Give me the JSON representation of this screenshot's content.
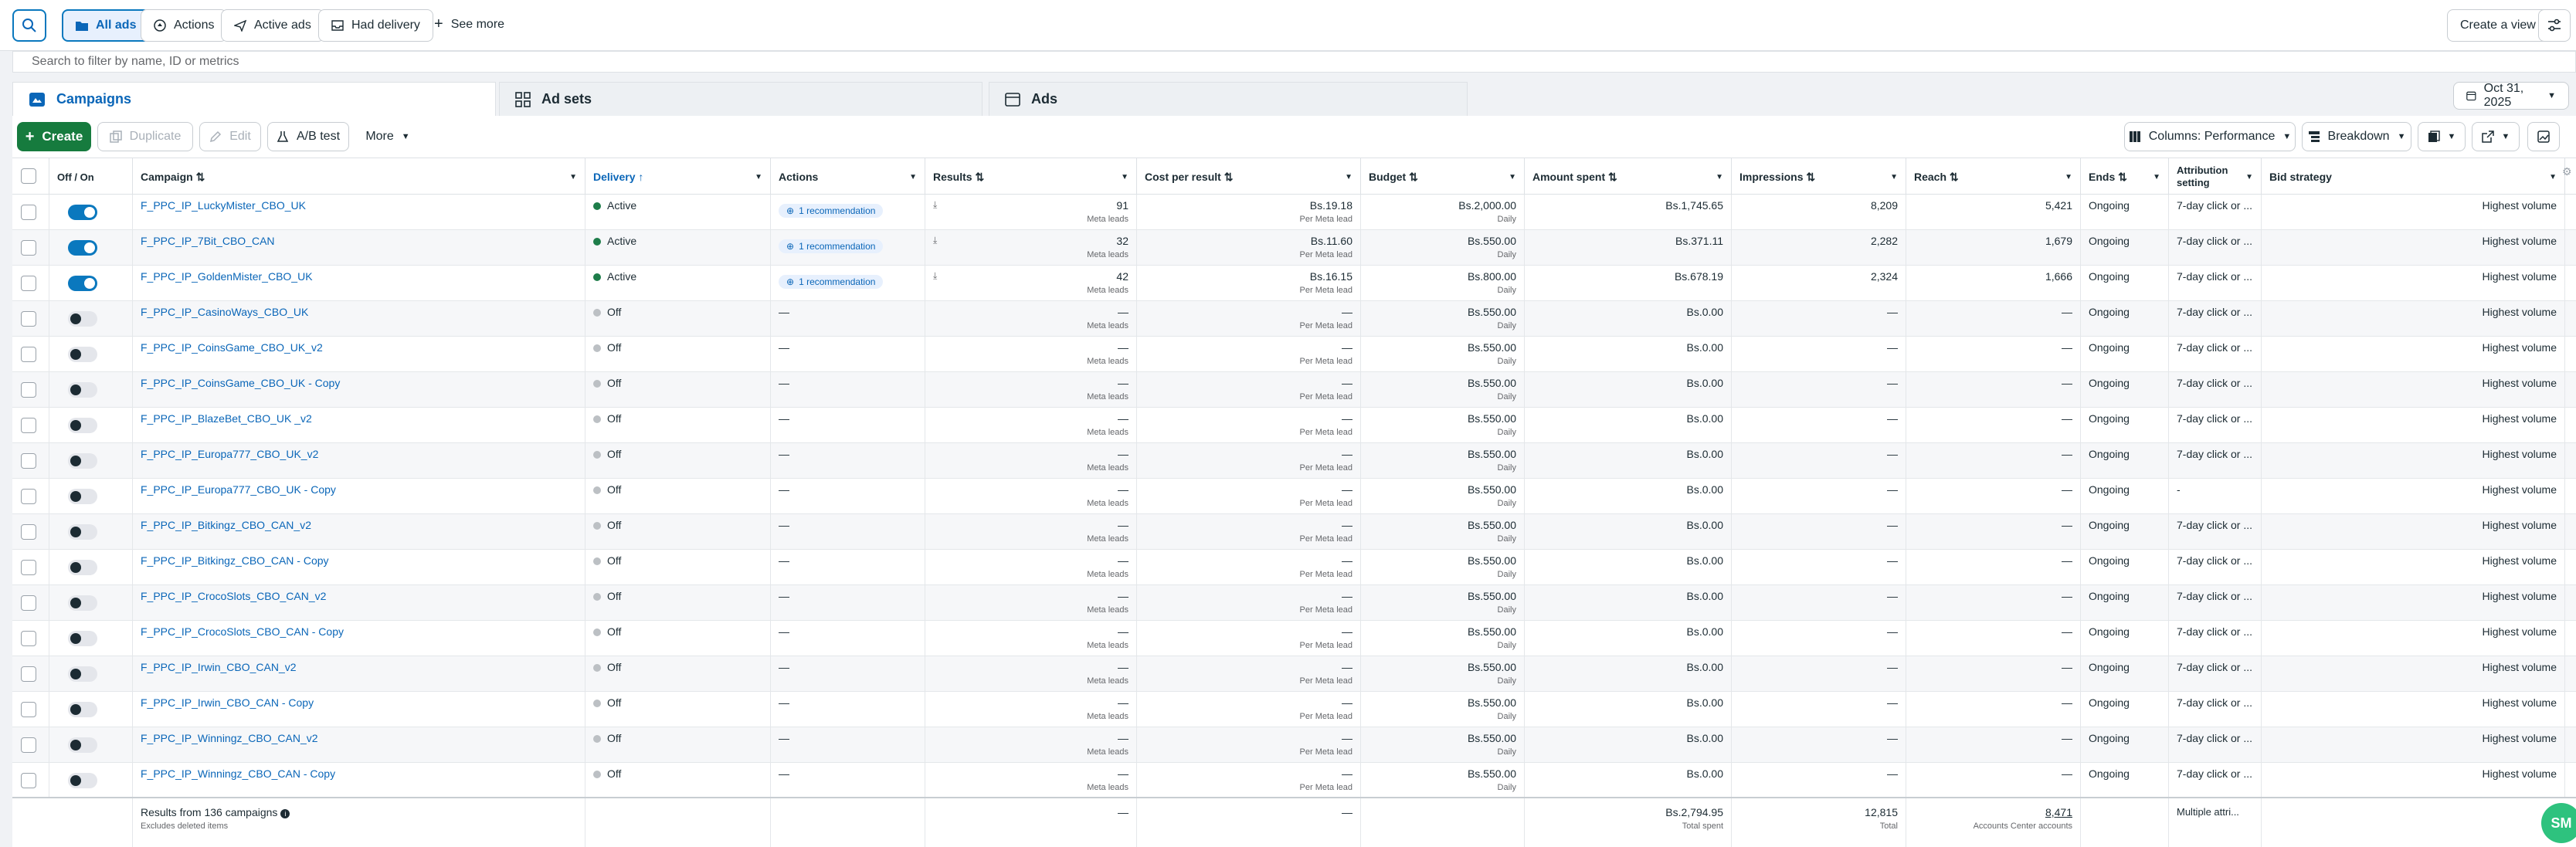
{
  "filters": {
    "all_ads": "All ads",
    "actions": "Actions",
    "active_ads": "Active ads",
    "had_delivery": "Had delivery",
    "see_more": "See more",
    "create_view": "Create a view"
  },
  "search": {
    "placeholder": "Search to filter by name, ID or metrics"
  },
  "tabs": {
    "campaigns": "Campaigns",
    "ad_sets": "Ad sets",
    "ads": "Ads"
  },
  "date": "Oct 31, 2025",
  "toolbar": {
    "create": "Create",
    "duplicate": "Duplicate",
    "edit": "Edit",
    "ab_test": "A/B test",
    "more": "More",
    "columns": "Columns: Performance",
    "breakdown": "Breakdown"
  },
  "headers": {
    "off_on": "Off / On",
    "campaign": "Campaign",
    "delivery": "Delivery",
    "actions": "Actions",
    "results": "Results",
    "cost_per_result": "Cost per result",
    "budget": "Budget",
    "amount_spent": "Amount spent",
    "impressions": "Impressions",
    "reach": "Reach",
    "ends": "Ends",
    "attribution": "Attribution setting",
    "bid_strategy": "Bid strategy"
  },
  "rows": [
    {
      "on": true,
      "name": "F_PPC_IP_LuckyMister_CBO_UK",
      "delivery": "Active",
      "action": "1 recommendation",
      "results": "91",
      "results_sub": "Meta leads",
      "cost": "Bs.19.18",
      "cost_sub": "Per Meta lead",
      "budget": "Bs.2,000.00",
      "budget_sub": "Daily",
      "spent": "Bs.1,745.65",
      "impressions": "8,209",
      "reach": "5,421",
      "ends": "Ongoing",
      "attribution": "7-day click or ...",
      "bid": "Highest volume"
    },
    {
      "on": true,
      "name": "F_PPC_IP_7Bit_CBO_CAN",
      "delivery": "Active",
      "action": "1 recommendation",
      "results": "32",
      "results_sub": "Meta leads",
      "cost": "Bs.11.60",
      "cost_sub": "Per Meta lead",
      "budget": "Bs.550.00",
      "budget_sub": "Daily",
      "spent": "Bs.371.11",
      "impressions": "2,282",
      "reach": "1,679",
      "ends": "Ongoing",
      "attribution": "7-day click or ...",
      "bid": "Highest volume"
    },
    {
      "on": true,
      "name": "F_PPC_IP_GoldenMister_CBO_UK",
      "delivery": "Active",
      "action": "1 recommendation",
      "results": "42",
      "results_sub": "Meta leads",
      "cost": "Bs.16.15",
      "cost_sub": "Per Meta lead",
      "budget": "Bs.800.00",
      "budget_sub": "Daily",
      "spent": "Bs.678.19",
      "impressions": "2,324",
      "reach": "1,666",
      "ends": "Ongoing",
      "attribution": "7-day click or ...",
      "bid": "Highest volume"
    },
    {
      "on": false,
      "name": "F_PPC_IP_CasinoWays_CBO_UK",
      "delivery": "Off",
      "action": "—",
      "results": "—",
      "results_sub": "Meta leads",
      "cost": "—",
      "cost_sub": "Per Meta lead",
      "budget": "Bs.550.00",
      "budget_sub": "Daily",
      "spent": "Bs.0.00",
      "impressions": "—",
      "reach": "—",
      "ends": "Ongoing",
      "attribution": "7-day click or ...",
      "bid": "Highest volume"
    },
    {
      "on": false,
      "name": "F_PPC_IP_CoinsGame_CBO_UK_v2",
      "delivery": "Off",
      "action": "—",
      "results": "—",
      "results_sub": "Meta leads",
      "cost": "—",
      "cost_sub": "Per Meta lead",
      "budget": "Bs.550.00",
      "budget_sub": "Daily",
      "spent": "Bs.0.00",
      "impressions": "—",
      "reach": "—",
      "ends": "Ongoing",
      "attribution": "7-day click or ...",
      "bid": "Highest volume"
    },
    {
      "on": false,
      "name": "F_PPC_IP_CoinsGame_CBO_UK - Copy",
      "delivery": "Off",
      "action": "—",
      "results": "—",
      "results_sub": "Meta leads",
      "cost": "—",
      "cost_sub": "Per Meta lead",
      "budget": "Bs.550.00",
      "budget_sub": "Daily",
      "spent": "Bs.0.00",
      "impressions": "—",
      "reach": "—",
      "ends": "Ongoing",
      "attribution": "7-day click or ...",
      "bid": "Highest volume"
    },
    {
      "on": false,
      "name": "F_PPC_IP_BlazeBet_CBO_UK _v2",
      "delivery": "Off",
      "action": "—",
      "results": "—",
      "results_sub": "Meta leads",
      "cost": "—",
      "cost_sub": "Per Meta lead",
      "budget": "Bs.550.00",
      "budget_sub": "Daily",
      "spent": "Bs.0.00",
      "impressions": "—",
      "reach": "—",
      "ends": "Ongoing",
      "attribution": "7-day click or ...",
      "bid": "Highest volume"
    },
    {
      "on": false,
      "name": "F_PPC_IP_Europa777_CBO_UK_v2",
      "delivery": "Off",
      "action": "—",
      "results": "—",
      "results_sub": "Meta leads",
      "cost": "—",
      "cost_sub": "Per Meta lead",
      "budget": "Bs.550.00",
      "budget_sub": "Daily",
      "spent": "Bs.0.00",
      "impressions": "—",
      "reach": "—",
      "ends": "Ongoing",
      "attribution": "7-day click or ...",
      "bid": "Highest volume"
    },
    {
      "on": false,
      "name": "F_PPC_IP_Europa777_CBO_UK - Copy",
      "delivery": "Off",
      "action": "—",
      "results": "—",
      "results_sub": "Meta leads",
      "cost": "—",
      "cost_sub": "Per Meta lead",
      "budget": "Bs.550.00",
      "budget_sub": "Daily",
      "spent": "Bs.0.00",
      "impressions": "—",
      "reach": "—",
      "ends": "Ongoing",
      "attribution": "-",
      "bid": "Highest volume"
    },
    {
      "on": false,
      "name": "F_PPC_IP_Bitkingz_CBO_CAN_v2",
      "delivery": "Off",
      "action": "—",
      "results": "—",
      "results_sub": "Meta leads",
      "cost": "—",
      "cost_sub": "Per Meta lead",
      "budget": "Bs.550.00",
      "budget_sub": "Daily",
      "spent": "Bs.0.00",
      "impressions": "—",
      "reach": "—",
      "ends": "Ongoing",
      "attribution": "7-day click or ...",
      "bid": "Highest volume"
    },
    {
      "on": false,
      "name": "F_PPC_IP_Bitkingz_CBO_CAN - Copy",
      "delivery": "Off",
      "action": "—",
      "results": "—",
      "results_sub": "Meta leads",
      "cost": "—",
      "cost_sub": "Per Meta lead",
      "budget": "Bs.550.00",
      "budget_sub": "Daily",
      "spent": "Bs.0.00",
      "impressions": "—",
      "reach": "—",
      "ends": "Ongoing",
      "attribution": "7-day click or ...",
      "bid": "Highest volume"
    },
    {
      "on": false,
      "name": "F_PPC_IP_CrocoSlots_CBO_CAN_v2",
      "delivery": "Off",
      "action": "—",
      "results": "—",
      "results_sub": "Meta leads",
      "cost": "—",
      "cost_sub": "Per Meta lead",
      "budget": "Bs.550.00",
      "budget_sub": "Daily",
      "spent": "Bs.0.00",
      "impressions": "—",
      "reach": "—",
      "ends": "Ongoing",
      "attribution": "7-day click or ...",
      "bid": "Highest volume"
    },
    {
      "on": false,
      "name": "F_PPC_IP_CrocoSlots_CBO_CAN - Copy",
      "delivery": "Off",
      "action": "—",
      "results": "—",
      "results_sub": "Meta leads",
      "cost": "—",
      "cost_sub": "Per Meta lead",
      "budget": "Bs.550.00",
      "budget_sub": "Daily",
      "spent": "Bs.0.00",
      "impressions": "—",
      "reach": "—",
      "ends": "Ongoing",
      "attribution": "7-day click or ...",
      "bid": "Highest volume"
    },
    {
      "on": false,
      "name": "F_PPC_IP_Irwin_CBO_CAN_v2",
      "delivery": "Off",
      "action": "—",
      "results": "—",
      "results_sub": "Meta leads",
      "cost": "—",
      "cost_sub": "Per Meta lead",
      "budget": "Bs.550.00",
      "budget_sub": "Daily",
      "spent": "Bs.0.00",
      "impressions": "—",
      "reach": "—",
      "ends": "Ongoing",
      "attribution": "7-day click or ...",
      "bid": "Highest volume"
    },
    {
      "on": false,
      "name": "F_PPC_IP_Irwin_CBO_CAN - Copy",
      "delivery": "Off",
      "action": "—",
      "results": "—",
      "results_sub": "Meta leads",
      "cost": "—",
      "cost_sub": "Per Meta lead",
      "budget": "Bs.550.00",
      "budget_sub": "Daily",
      "spent": "Bs.0.00",
      "impressions": "—",
      "reach": "—",
      "ends": "Ongoing",
      "attribution": "7-day click or ...",
      "bid": "Highest volume"
    },
    {
      "on": false,
      "name": "F_PPC_IP_Winningz_CBO_CAN_v2",
      "delivery": "Off",
      "action": "—",
      "results": "—",
      "results_sub": "Meta leads",
      "cost": "—",
      "cost_sub": "Per Meta lead",
      "budget": "Bs.550.00",
      "budget_sub": "Daily",
      "spent": "Bs.0.00",
      "impressions": "—",
      "reach": "—",
      "ends": "Ongoing",
      "attribution": "7-day click or ...",
      "bid": "Highest volume"
    },
    {
      "on": false,
      "name": "F_PPC_IP_Winningz_CBO_CAN - Copy",
      "delivery": "Off",
      "action": "—",
      "results": "—",
      "results_sub": "Meta leads",
      "cost": "—",
      "cost_sub": "Per Meta lead",
      "budget": "Bs.550.00",
      "budget_sub": "Daily",
      "spent": "Bs.0.00",
      "impressions": "—",
      "reach": "—",
      "ends": "Ongoing",
      "attribution": "7-day click or ...",
      "bid": "Highest volume"
    }
  ],
  "footer": {
    "results_from": "Results from 136 campaigns",
    "excludes": "Excludes deleted items",
    "results": "—",
    "cost": "—",
    "spent": "Bs.2,794.95",
    "spent_sub": "Total spent",
    "impressions": "12,815",
    "impressions_sub": "Total",
    "reach": "8,471",
    "reach_sub": "Accounts Center accounts",
    "attribution": "Multiple attri..."
  },
  "fab_label": "SM",
  "colors": {
    "accent": "#0a78be",
    "active": "#1e7d4a",
    "off": "#bcc0c4",
    "create": "#167b3e"
  }
}
